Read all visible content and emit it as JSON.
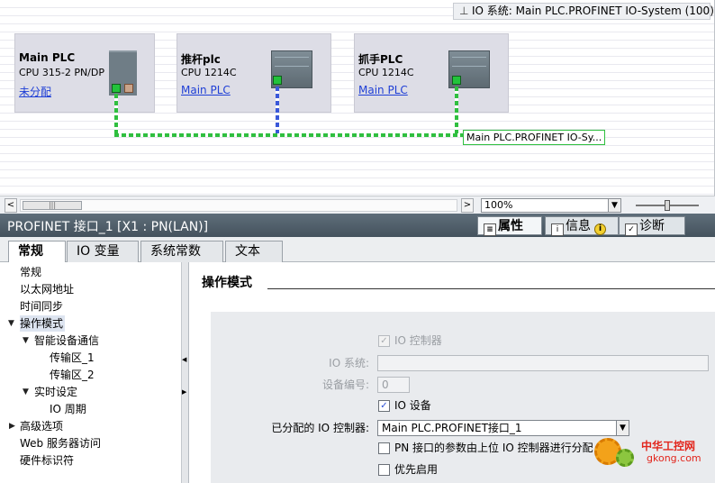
{
  "network": {
    "io_system_header": "IO 系统: Main PLC.PROFINET IO-System (100)",
    "devices": [
      {
        "name": "Main PLC",
        "type": "CPU 315-2 PN/DP",
        "link": "未分配"
      },
      {
        "name": "推杆plc",
        "type": "CPU 1214C",
        "link": "Main PLC"
      },
      {
        "name": "抓手PLC",
        "type": "CPU 1214C",
        "link": "Main PLC"
      }
    ],
    "bus_label": "Main PLC.PROFINET IO-Sy...",
    "zoom": "100%",
    "colors": {
      "bus_green": "#2fbf3f",
      "bus_blue": "#3a58d9",
      "link": "#1f3fd6"
    }
  },
  "properties": {
    "title": "PROFINET 接口_1 [X1 : PN(LAN)]",
    "top_tabs": {
      "properties": "属性",
      "info": "信息",
      "diagnostics": "诊断"
    },
    "sub_tabs": [
      "常规",
      "IO 变量",
      "系统常数",
      "文本"
    ],
    "nav": [
      {
        "label": "常规",
        "level": 0
      },
      {
        "label": "以太网地址",
        "level": 0
      },
      {
        "label": "时间同步",
        "level": 0
      },
      {
        "label": "操作模式",
        "level": 0,
        "expanded": true,
        "selected": true
      },
      {
        "label": "智能设备通信",
        "level": 1,
        "expanded": true
      },
      {
        "label": "传输区_1",
        "level": 2
      },
      {
        "label": "传输区_2",
        "level": 2
      },
      {
        "label": "实时设定",
        "level": 1,
        "expanded": true
      },
      {
        "label": "IO 周期",
        "level": 2
      },
      {
        "label": "高级选项",
        "level": 0,
        "collapsed": true
      },
      {
        "label": "Web 服务器访问",
        "level": 0
      },
      {
        "label": "硬件标识符",
        "level": 0
      }
    ],
    "section_title": "操作模式",
    "form": {
      "io_controller_label": "IO 控制器",
      "io_system_label": "IO 系统:",
      "io_system_value": "",
      "device_number_label": "设备编号:",
      "device_number_value": "0",
      "io_device_label": "IO 设备",
      "assigned_controller_label": "已分配的 IO 控制器:",
      "assigned_controller_value": "Main PLC.PROFINET接口_1",
      "pn_param_label": "PN 接口的参数由上位 IO 控制器进行分配",
      "priority_label": "优先启用"
    }
  },
  "watermark": {
    "line1": "中华工控网",
    "line2": "gkong.com"
  }
}
